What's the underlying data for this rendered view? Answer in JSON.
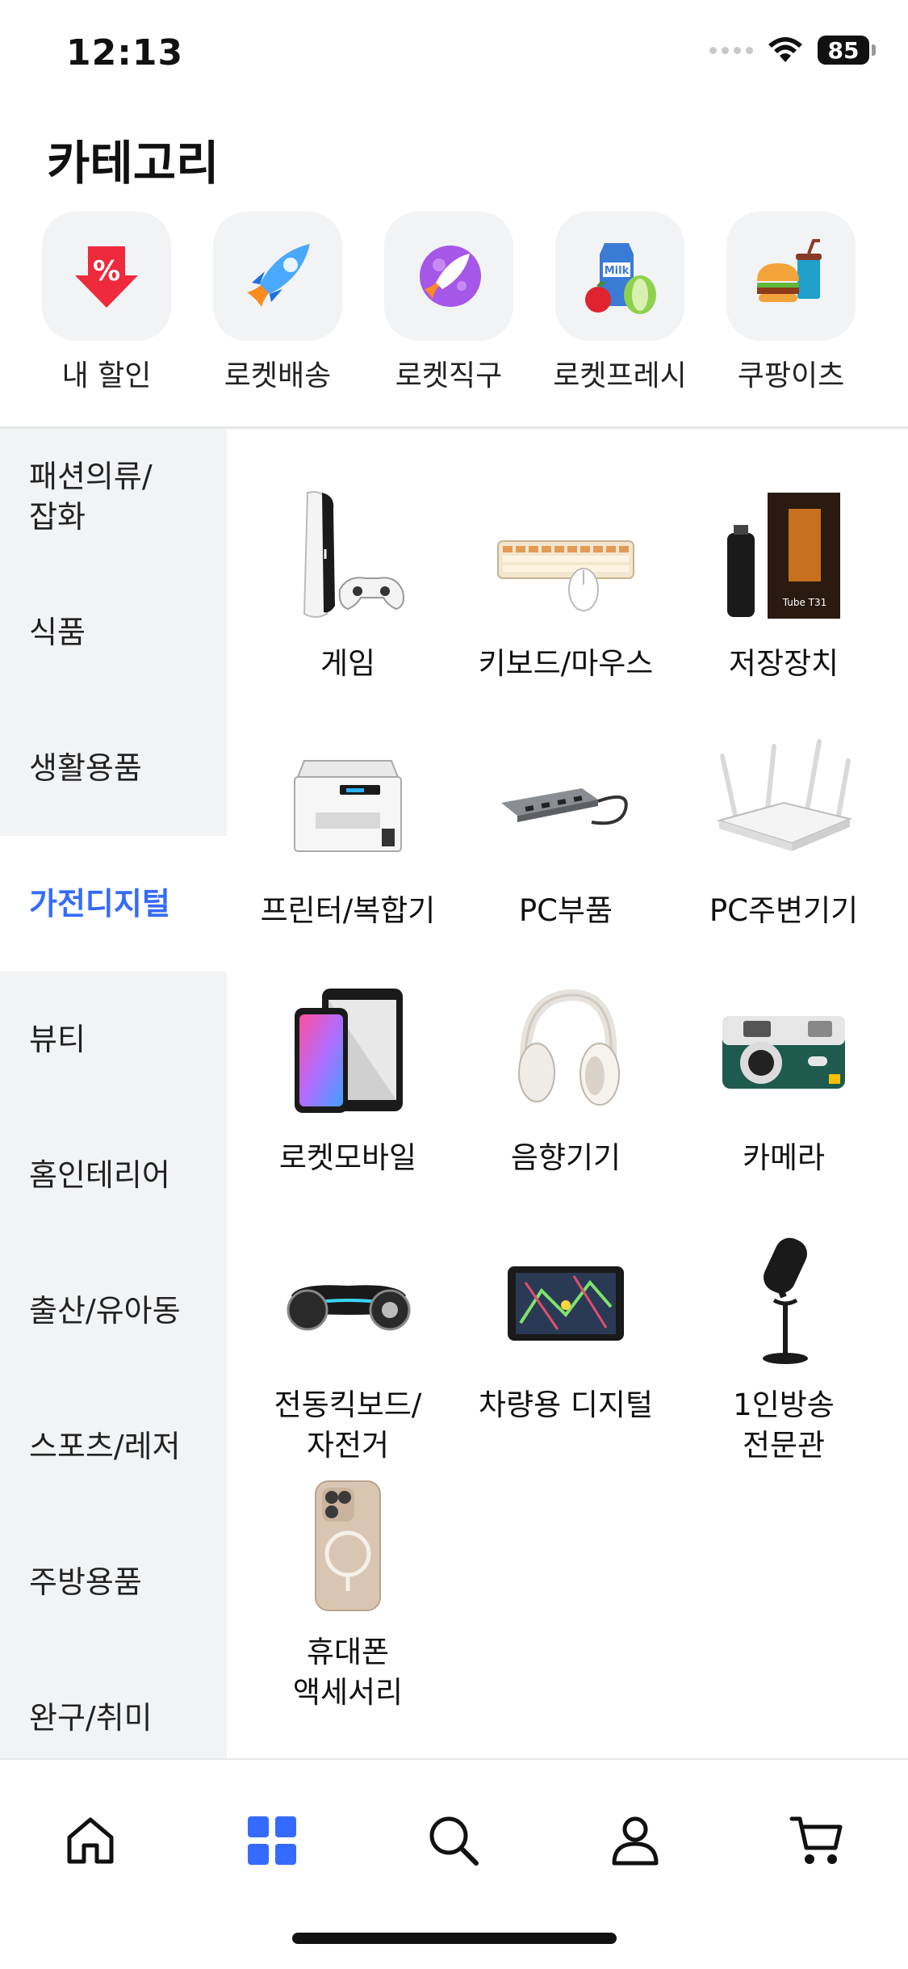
{
  "status_bar": {
    "time": "12:13",
    "battery": "85"
  },
  "page": {
    "title": "카테고리"
  },
  "quick_categories": [
    {
      "label": "내 할인",
      "icon": "discount-tag-icon"
    },
    {
      "label": "로켓배송",
      "icon": "rocket-icon"
    },
    {
      "label": "로켓직구",
      "icon": "purple-rocket-icon"
    },
    {
      "label": "로켓프레시",
      "icon": "fresh-grocery-icon"
    },
    {
      "label": "쿠팡이츠",
      "icon": "burger-drink-icon"
    }
  ],
  "sidebar": {
    "items": [
      {
        "label": "패션의류/\n잡화"
      },
      {
        "label": "식품"
      },
      {
        "label": "생활용품"
      },
      {
        "label": "가전디지털",
        "active": true
      },
      {
        "label": "뷰티"
      },
      {
        "label": "홈인테리어"
      },
      {
        "label": "출산/유아동"
      },
      {
        "label": "스포츠/레저"
      },
      {
        "label": "주방용품"
      },
      {
        "label": "완구/취미"
      }
    ]
  },
  "subcategories": [
    {
      "label": "게임",
      "icon": "game-console-icon"
    },
    {
      "label": "키보드/마우스",
      "icon": "keyboard-mouse-icon"
    },
    {
      "label": "저장장치",
      "icon": "storage-device-icon"
    },
    {
      "label": "프린터/복합기",
      "icon": "printer-icon"
    },
    {
      "label": "PC부품",
      "icon": "usb-hub-icon"
    },
    {
      "label": "PC주변기기",
      "icon": "router-icon"
    },
    {
      "label": "로켓모바일",
      "icon": "mobile-tablet-icon"
    },
    {
      "label": "음향기기",
      "icon": "headphones-icon"
    },
    {
      "label": "카메라",
      "icon": "camera-icon"
    },
    {
      "label": "전동킥보드/\n자전거",
      "icon": "hoverboard-icon"
    },
    {
      "label": "차량용 디지털",
      "icon": "car-navigation-icon"
    },
    {
      "label": "1인방송\n전문관",
      "icon": "microphone-icon"
    },
    {
      "label": "휴대폰\n액세서리",
      "icon": "phone-case-icon"
    }
  ],
  "bottom_nav": [
    {
      "name": "home",
      "icon": "home-icon"
    },
    {
      "name": "category",
      "icon": "category-grid-icon",
      "active": true
    },
    {
      "name": "search",
      "icon": "search-icon"
    },
    {
      "name": "my",
      "icon": "user-icon"
    },
    {
      "name": "cart",
      "icon": "cart-icon"
    }
  ],
  "colors": {
    "accent": "#346aff",
    "sidebar_bg": "#f2f3f5",
    "text": "#111111"
  }
}
